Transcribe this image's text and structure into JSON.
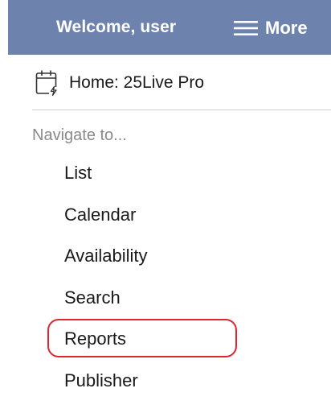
{
  "header": {
    "welcome_text": "Welcome, user",
    "more_label": "More",
    "background_color": "#6d83ad",
    "more_icon": "hamburger-icon"
  },
  "home": {
    "label": "Home: 25Live Pro",
    "icon": "calendar-icon"
  },
  "navigation": {
    "heading": "Navigate to...",
    "items": [
      {
        "label": "List"
      },
      {
        "label": "Calendar"
      },
      {
        "label": "Availability"
      },
      {
        "label": "Search"
      },
      {
        "label": "Reports",
        "highlighted": true
      },
      {
        "label": "Publisher"
      }
    ]
  },
  "annotation": {
    "highlight_color": "#e0252f",
    "highlighted_item": "Reports"
  }
}
